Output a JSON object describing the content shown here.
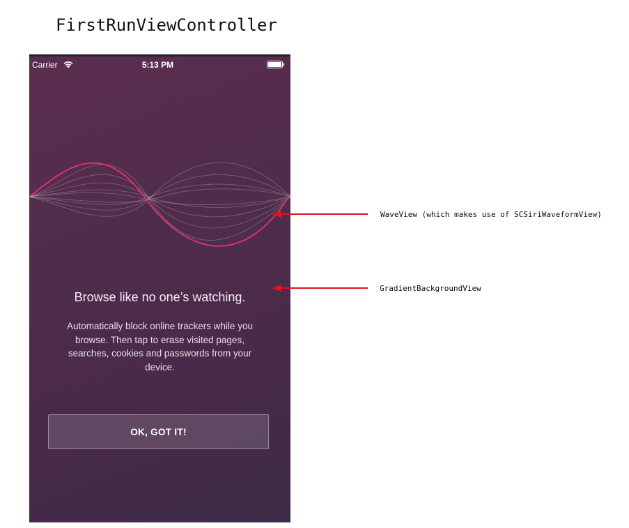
{
  "page": {
    "title": "FirstRunViewController"
  },
  "status_bar": {
    "carrier": "Carrier",
    "time": "5:13 PM",
    "wifi_icon": "wifi-icon",
    "battery_icon": "battery-icon"
  },
  "first_run": {
    "headline": "Browse like no one’s watching.",
    "body": "Automatically block online trackers while you browse. Then tap to erase visited pages, searches, cookies and passwords from your device.",
    "button_label": "OK, GOT IT!"
  },
  "annotations": [
    {
      "label": "WaveView (which makes use of SCSiriWaveformView)"
    },
    {
      "label": "GradientBackgroundView"
    }
  ],
  "colors": {
    "background_gradient_start": "#5b2d4f",
    "background_gradient_end": "#3c2b46",
    "wave_accent": "#d6336c",
    "callout_arrow": "#e0121f"
  }
}
